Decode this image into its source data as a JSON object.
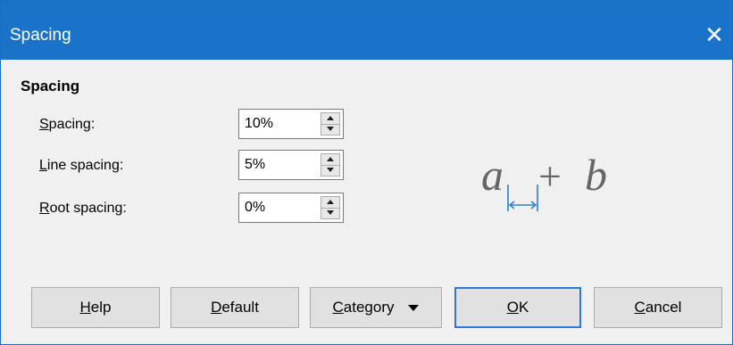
{
  "window": {
    "title": "Spacing",
    "close_symbol": "✕"
  },
  "section": {
    "title": "Spacing"
  },
  "fields": [
    {
      "label_accel": "S",
      "label_rest": "pacing:",
      "value": "10%"
    },
    {
      "label_accel": "L",
      "label_rest": "ine spacing:",
      "value": "5%"
    },
    {
      "label_accel": "R",
      "label_rest": "oot spacing:",
      "value": "0%"
    }
  ],
  "preview": {
    "left_char": "a",
    "operator": "+",
    "right_char": "b"
  },
  "buttons": [
    {
      "accel": "H",
      "rest": "elp"
    },
    {
      "accel": "D",
      "rest": "efault"
    },
    {
      "accel": "C",
      "rest": "ategory"
    },
    {
      "accel": "O",
      "rest": "K"
    },
    {
      "accel": "C",
      "rest": "ancel"
    }
  ],
  "colors": {
    "titlebar": "#1a73c9",
    "accent": "#2d7bd6",
    "dimension": "#2b7fd4"
  }
}
